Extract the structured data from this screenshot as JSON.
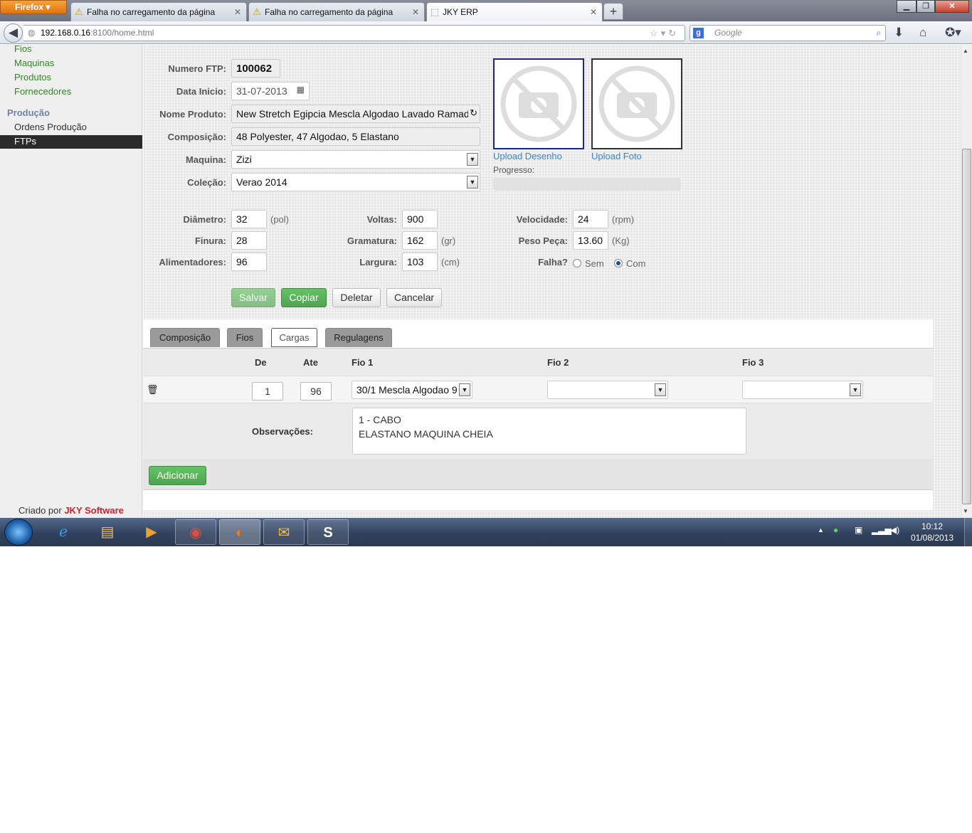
{
  "browser": {
    "app_button": "Firefox",
    "tabs": [
      {
        "title": "Falha no carregamento da página"
      },
      {
        "title": "Falha no carregamento da página"
      },
      {
        "title": "JKY ERP"
      }
    ],
    "url_host": "192.168.0.16",
    "url_rest": ":8100/home.html",
    "search_placeholder": "Google"
  },
  "sidebar": {
    "items_top": [
      "Fios",
      "Maquinas",
      "Produtos",
      "Fornecedores"
    ],
    "section": "Produção",
    "items": [
      "Ordens Produção",
      "FTPs"
    ],
    "credit_prefix": "Criado por",
    "credit_brand": "JKY Software"
  },
  "form": {
    "numero_label": "Numero FTP:",
    "numero_value": "100062",
    "data_label": "Data Inicio:",
    "data_value": "31-07-2013",
    "produto_label": "Nome Produto:",
    "produto_value": "New Stretch Egipcia Mescla Algodao Lavado Ramado",
    "composicao_label": "Composição:",
    "composicao_value": "48 Polyester, 47 Algodao, 5 Elastano",
    "maquina_label": "Maquina:",
    "maquina_value": "Zizi",
    "colecao_label": "Coleção:",
    "colecao_value": "Verao 2014",
    "upload_desenho": "Upload Desenho",
    "upload_foto": "Upload Foto",
    "progresso_label": "Progresso:",
    "diametro_label": "Diâmetro:",
    "diametro_value": "32",
    "diametro_unit": "(pol)",
    "finura_label": "Finura:",
    "finura_value": "28",
    "alimentadores_label": "Alimentadores:",
    "alimentadores_value": "96",
    "voltas_label": "Voltas:",
    "voltas_value": "900",
    "gramatura_label": "Gramatura:",
    "gramatura_value": "162",
    "gramatura_unit": "(gr)",
    "largura_label": "Largura:",
    "largura_value": "103",
    "largura_unit": "(cm)",
    "velocidade_label": "Velocidade:",
    "velocidade_value": "24",
    "velocidade_unit": "(rpm)",
    "peso_label": "Peso Peça:",
    "peso_value": "13.60",
    "peso_unit": "(Kg)",
    "falha_label": "Falha?",
    "falha_sem": "Sem",
    "falha_com": "Com",
    "falha_selected": "Com"
  },
  "actions": {
    "salvar": "Salvar",
    "copiar": "Copiar",
    "deletar": "Deletar",
    "cancelar": "Cancelar"
  },
  "detail_tabs": [
    "Composição",
    "Fios",
    "Cargas",
    "Regulagens"
  ],
  "active_detail_tab": "Cargas",
  "cargas": {
    "headers": {
      "de": "De",
      "ate": "Ate",
      "fio1": "Fio 1",
      "fio2": "Fio 2",
      "fio3": "Fio 3"
    },
    "rows": [
      {
        "de": "1",
        "ate": "96",
        "fio1": "30/1 Mescla Algodao 9",
        "fio2": "",
        "fio3": ""
      }
    ],
    "observacoes_label": "Observações:",
    "observacoes_value": "1 - CABO\nELASTANO MAQUINA CHEIA",
    "adicionar": "Adicionar"
  },
  "taskbar": {
    "time": "10:12",
    "date": "01/08/2013"
  },
  "colors": {
    "accent_green": "#51a351",
    "sidebar_link": "#2f8a1f",
    "brand_red": "#c1272d"
  }
}
